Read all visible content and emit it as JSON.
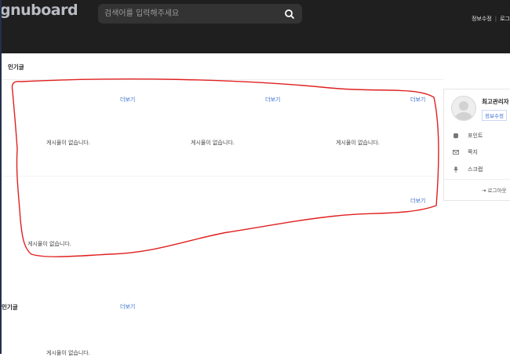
{
  "header": {
    "logo": "gnuboard",
    "search_placeholder": "검색어를 입력해주세요",
    "user_links": [
      "정보수정",
      "로그"
    ]
  },
  "main": {
    "section_title": "인기글",
    "more_label": "더보기",
    "empty_message": "게시물이 없습니다."
  },
  "lower_section": {
    "title": "인기글",
    "more_label": "더보기",
    "empty_message": "게시물이 없습니다."
  },
  "profile": {
    "name": "최고관리자",
    "edit_label": "정보수정",
    "menu": [
      "포인트",
      "쪽지",
      "스크랩"
    ],
    "logout_label": "로그아웃"
  },
  "annotation": {
    "stroke_color": "#e02020"
  }
}
